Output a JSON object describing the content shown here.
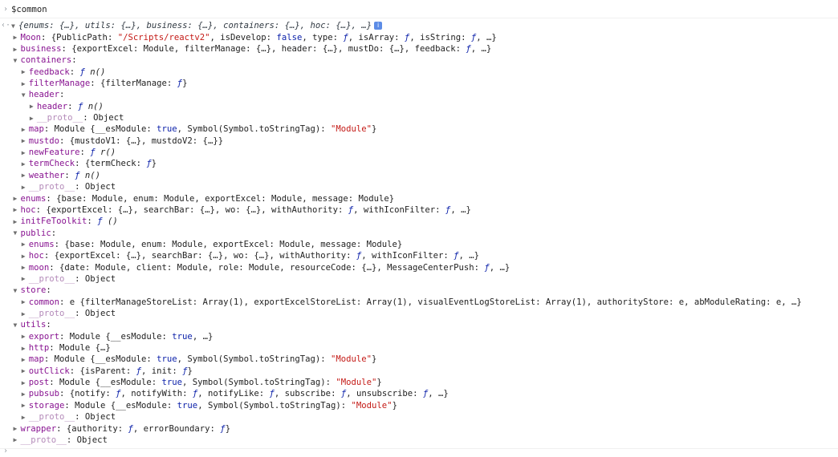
{
  "prompt": {
    "glyph": "›",
    "input": "$common"
  },
  "result": {
    "glyph": "‹·",
    "summary": "{enums: {…}, utils: {…}, business: {…}, containers: {…}, hoc: {…}, …}",
    "info_glyph": "i"
  },
  "tree": [
    {
      "d": 1,
      "t": "c",
      "k": "Moon",
      "p": [
        [
          "p",
          "{PublicPath: "
        ],
        [
          "s",
          "\"/Scripts/reactv2\""
        ],
        [
          "p",
          ", isDevelop: "
        ],
        [
          "b",
          "false"
        ],
        [
          "p",
          ", type: "
        ],
        [
          "f",
          "ƒ"
        ],
        [
          "p",
          ", isArray: "
        ],
        [
          "f",
          "ƒ"
        ],
        [
          "p",
          ", isString: "
        ],
        [
          "f",
          "ƒ"
        ],
        [
          "p",
          ", …}"
        ]
      ]
    },
    {
      "d": 1,
      "t": "c",
      "k": "business",
      "p": [
        [
          "p",
          "{exportExcel: Module, filterManage: {…}, header: {…}, mustDo: {…}, feedback: "
        ],
        [
          "f",
          "ƒ"
        ],
        [
          "p",
          ", …}"
        ]
      ]
    },
    {
      "d": 1,
      "t": "o",
      "k": "containers",
      "p": []
    },
    {
      "d": 2,
      "t": "c",
      "k": "feedback",
      "p": [
        [
          "f",
          "ƒ"
        ],
        [
          "i",
          " n()"
        ]
      ]
    },
    {
      "d": 2,
      "t": "c",
      "k": "filterManage",
      "p": [
        [
          "p",
          "{filterManage: "
        ],
        [
          "f",
          "ƒ"
        ],
        [
          "p",
          "}"
        ]
      ]
    },
    {
      "d": 2,
      "t": "o",
      "k": "header",
      "p": []
    },
    {
      "d": 3,
      "t": "c",
      "k": "header",
      "p": [
        [
          "f",
          "ƒ"
        ],
        [
          "i",
          " n()"
        ]
      ]
    },
    {
      "d": 3,
      "t": "c",
      "k": "__proto__",
      "x": 1,
      "p": [
        [
          "p",
          "Object"
        ]
      ]
    },
    {
      "d": 2,
      "t": "c",
      "k": "map",
      "p": [
        [
          "p",
          "Module {__esModule: "
        ],
        [
          "b",
          "true"
        ],
        [
          "p",
          ", Symbol(Symbol.toStringTag): "
        ],
        [
          "s",
          "\"Module\""
        ],
        [
          "p",
          "}"
        ]
      ]
    },
    {
      "d": 2,
      "t": "c",
      "k": "mustdo",
      "p": [
        [
          "p",
          "{mustdoV1: {…}, mustdoV2: {…}}"
        ]
      ]
    },
    {
      "d": 2,
      "t": "c",
      "k": "newFeature",
      "p": [
        [
          "f",
          "ƒ"
        ],
        [
          "i",
          " r()"
        ]
      ]
    },
    {
      "d": 2,
      "t": "c",
      "k": "termCheck",
      "p": [
        [
          "p",
          "{termCheck: "
        ],
        [
          "f",
          "ƒ"
        ],
        [
          "p",
          "}"
        ]
      ]
    },
    {
      "d": 2,
      "t": "c",
      "k": "weather",
      "p": [
        [
          "f",
          "ƒ"
        ],
        [
          "i",
          " n()"
        ]
      ]
    },
    {
      "d": 2,
      "t": "c",
      "k": "__proto__",
      "x": 1,
      "p": [
        [
          "p",
          "Object"
        ]
      ]
    },
    {
      "d": 1,
      "t": "c",
      "k": "enums",
      "p": [
        [
          "p",
          "{base: Module, enum: Module, exportExcel: Module, message: Module}"
        ]
      ]
    },
    {
      "d": 1,
      "t": "c",
      "k": "hoc",
      "p": [
        [
          "p",
          "{exportExcel: {…}, searchBar: {…}, wo: {…}, withAuthority: "
        ],
        [
          "f",
          "ƒ"
        ],
        [
          "p",
          ", withIconFilter: "
        ],
        [
          "f",
          "ƒ"
        ],
        [
          "p",
          ", …}"
        ]
      ]
    },
    {
      "d": 1,
      "t": "c",
      "k": "initFeToolkit",
      "p": [
        [
          "f",
          "ƒ"
        ],
        [
          "i",
          " ()"
        ]
      ]
    },
    {
      "d": 1,
      "t": "o",
      "k": "public",
      "p": []
    },
    {
      "d": 2,
      "t": "c",
      "k": "enums",
      "p": [
        [
          "p",
          "{base: Module, enum: Module, exportExcel: Module, message: Module}"
        ]
      ]
    },
    {
      "d": 2,
      "t": "c",
      "k": "hoc",
      "p": [
        [
          "p",
          "{exportExcel: {…}, searchBar: {…}, wo: {…}, withAuthority: "
        ],
        [
          "f",
          "ƒ"
        ],
        [
          "p",
          ", withIconFilter: "
        ],
        [
          "f",
          "ƒ"
        ],
        [
          "p",
          ", …}"
        ]
      ]
    },
    {
      "d": 2,
      "t": "c",
      "k": "moon",
      "p": [
        [
          "p",
          "{date: Module, client: Module, role: Module, resourceCode: {…}, MessageCenterPush: "
        ],
        [
          "f",
          "ƒ"
        ],
        [
          "p",
          ", …}"
        ]
      ]
    },
    {
      "d": 2,
      "t": "c",
      "k": "__proto__",
      "x": 1,
      "p": [
        [
          "p",
          "Object"
        ]
      ]
    },
    {
      "d": 1,
      "t": "o",
      "k": "store",
      "p": []
    },
    {
      "d": 2,
      "t": "c",
      "k": "common",
      "p": [
        [
          "p",
          "e {filterManageStoreList: Array(1), exportExcelStoreList: Array(1), visualEventLogStoreList: Array(1), authorityStore: e, abModuleRating: e, …}"
        ]
      ]
    },
    {
      "d": 2,
      "t": "c",
      "k": "__proto__",
      "x": 1,
      "p": [
        [
          "p",
          "Object"
        ]
      ]
    },
    {
      "d": 1,
      "t": "o",
      "k": "utils",
      "p": []
    },
    {
      "d": 2,
      "t": "c",
      "k": "export",
      "p": [
        [
          "p",
          "Module {__esModule: "
        ],
        [
          "b",
          "true"
        ],
        [
          "p",
          ", …}"
        ]
      ]
    },
    {
      "d": 2,
      "t": "c",
      "k": "http",
      "p": [
        [
          "p",
          "Module {…}"
        ]
      ]
    },
    {
      "d": 2,
      "t": "c",
      "k": "map",
      "p": [
        [
          "p",
          "Module {__esModule: "
        ],
        [
          "b",
          "true"
        ],
        [
          "p",
          ", Symbol(Symbol.toStringTag): "
        ],
        [
          "s",
          "\"Module\""
        ],
        [
          "p",
          "}"
        ]
      ]
    },
    {
      "d": 2,
      "t": "c",
      "k": "outClick",
      "p": [
        [
          "p",
          "{isParent: "
        ],
        [
          "f",
          "ƒ"
        ],
        [
          "p",
          ", init: "
        ],
        [
          "f",
          "ƒ"
        ],
        [
          "p",
          "}"
        ]
      ]
    },
    {
      "d": 2,
      "t": "c",
      "k": "post",
      "p": [
        [
          "p",
          "Module {__esModule: "
        ],
        [
          "b",
          "true"
        ],
        [
          "p",
          ", Symbol(Symbol.toStringTag): "
        ],
        [
          "s",
          "\"Module\""
        ],
        [
          "p",
          "}"
        ]
      ]
    },
    {
      "d": 2,
      "t": "c",
      "k": "pubsub",
      "p": [
        [
          "p",
          "{notify: "
        ],
        [
          "f",
          "ƒ"
        ],
        [
          "p",
          ", notifyWith: "
        ],
        [
          "f",
          "ƒ"
        ],
        [
          "p",
          ", notifyLike: "
        ],
        [
          "f",
          "ƒ"
        ],
        [
          "p",
          ", subscribe: "
        ],
        [
          "f",
          "ƒ"
        ],
        [
          "p",
          ", unsubscribe: "
        ],
        [
          "f",
          "ƒ"
        ],
        [
          "p",
          ", …}"
        ]
      ]
    },
    {
      "d": 2,
      "t": "c",
      "k": "storage",
      "p": [
        [
          "p",
          "Module {__esModule: "
        ],
        [
          "b",
          "true"
        ],
        [
          "p",
          ", Symbol(Symbol.toStringTag): "
        ],
        [
          "s",
          "\"Module\""
        ],
        [
          "p",
          "}"
        ]
      ]
    },
    {
      "d": 2,
      "t": "c",
      "k": "__proto__",
      "x": 1,
      "p": [
        [
          "p",
          "Object"
        ]
      ]
    },
    {
      "d": 1,
      "t": "c",
      "k": "wrapper",
      "p": [
        [
          "p",
          "{authority: "
        ],
        [
          "f",
          "ƒ"
        ],
        [
          "p",
          ", errorBoundary: "
        ],
        [
          "f",
          "ƒ"
        ],
        [
          "p",
          "}"
        ]
      ]
    },
    {
      "d": 1,
      "t": "c",
      "k": "__proto__",
      "x": 1,
      "p": [
        [
          "p",
          "Object"
        ]
      ]
    }
  ],
  "next_prompt": {
    "glyph": "›"
  },
  "colors": {
    "key": "#881391",
    "string": "#c41a16",
    "keyword": "#0d22aa",
    "proto_key": "#b48ab9"
  }
}
